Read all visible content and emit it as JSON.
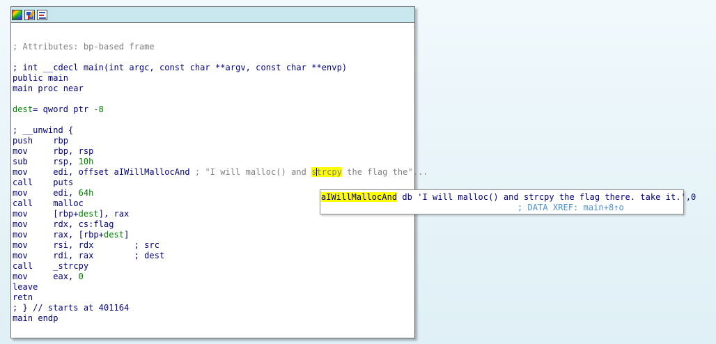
{
  "toolbar": {
    "buttons": [
      {
        "icon": "color-palette-icon",
        "title": "Color"
      },
      {
        "icon": "graph-overview-icon",
        "title": "Graph overview"
      },
      {
        "icon": "text-view-icon",
        "title": "Text view"
      }
    ]
  },
  "listing": {
    "attributes_comment": "; Attributes: bp-based frame",
    "signature_comment": "; int __cdecl main(int argc, const char **argv, const char **envp)",
    "public_line": "public main",
    "proc_line": "main proc near",
    "dest_var": "dest",
    "dest_def": "= qword ptr ",
    "dest_off": "-8",
    "unwind_comment": "; __unwind {",
    "ins": [
      {
        "m": "push",
        "op": "rbp"
      },
      {
        "m": "mov",
        "op": "rbp, rsp"
      },
      {
        "m": "sub",
        "op": "rsp, ",
        "num": "10h"
      },
      {
        "m": "mov",
        "op": "edi, offset aIWillMallocAnd ",
        "c_pre": "; \"I will malloc() and ",
        "c_hl_a": "s",
        "c_hl_b": "trcpy",
        "c_post": " the flag the\"..."
      },
      {
        "m": "call",
        "op": "puts"
      },
      {
        "m": "mov",
        "op": "edi, ",
        "num": "64h"
      },
      {
        "m": "call",
        "op": "malloc"
      },
      {
        "m": "mov",
        "op_a": "[rbp+",
        "op_var": "dest",
        "op_b": "], rax"
      },
      {
        "m": "mov",
        "op": "rdx, cs:flag"
      },
      {
        "m": "mov",
        "op_a": "rax, [rbp+",
        "op_var": "dest",
        "op_b": "]"
      },
      {
        "m": "mov",
        "op": "rsi, rdx",
        "cmt": "; src"
      },
      {
        "m": "mov",
        "op": "rdi, rax",
        "cmt": "; dest"
      },
      {
        "m": "call",
        "op": "_strcpy"
      },
      {
        "m": "mov",
        "op": "eax, ",
        "num": "0"
      },
      {
        "m": "leave",
        "op": ""
      },
      {
        "m": "retn",
        "op": ""
      }
    ],
    "starts_comment": "; } // starts at 401164",
    "endp_line": "main endp"
  },
  "hint": {
    "label": "aIWillMallocAnd",
    "rest": " db 'I will malloc() and strcpy the flag there. take it.',0",
    "xref": "; DATA XREF: main+8↑o"
  },
  "colors": {
    "background": "#e6f3f8",
    "titlebar": "#c9e7ee",
    "code": "#000080",
    "comment": "#808080",
    "number": "#008000",
    "highlight": "#ffff00"
  }
}
